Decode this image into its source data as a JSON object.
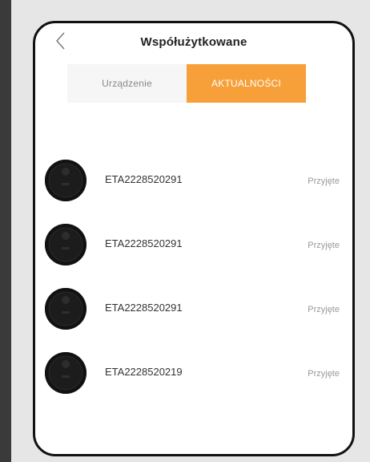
{
  "header": {
    "title": "Współużytkowane"
  },
  "tabs": [
    {
      "label": "Urządzenie",
      "active": false
    },
    {
      "label": "AKTUALNOŚCI",
      "active": true
    }
  ],
  "devices": [
    {
      "id": "ETA2228520291",
      "status": "Przyjęte"
    },
    {
      "id": "ETA2228520291",
      "status": "Przyjęte"
    },
    {
      "id": "ETA2228520291",
      "status": "Przyjęte"
    },
    {
      "id": "ETA2228520219",
      "status": "Przyjęte"
    }
  ],
  "colors": {
    "accent": "#f7a03a",
    "frame": "#111111"
  }
}
